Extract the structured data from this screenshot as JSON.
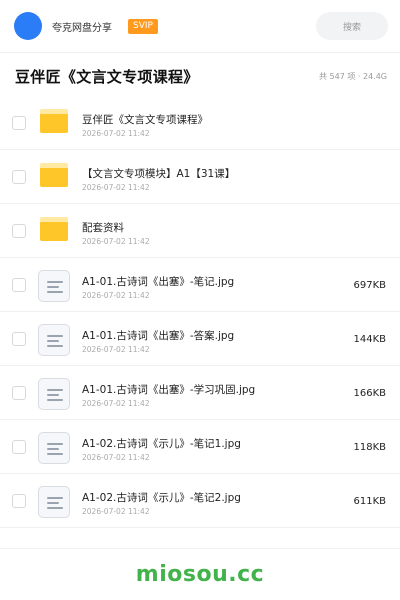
{
  "header": {
    "app_name": "夸克网盘分享",
    "badge": "SVIP",
    "search_placeholder": "搜索"
  },
  "folder": {
    "title": "豆伴匠《文言文专项课程》",
    "summary": "共 547 项 · 24.4G"
  },
  "items": [
    {
      "type": "folder",
      "name": "豆伴匠《文言文专项课程》",
      "date": "2026-07-02 11:42",
      "size": ""
    },
    {
      "type": "folder",
      "name": "【文言文专项模块】A1【31课】",
      "date": "2026-07-02 11:42",
      "size": ""
    },
    {
      "type": "folder",
      "name": "配套资料",
      "date": "2026-07-02 11:42",
      "size": ""
    },
    {
      "type": "file",
      "name": "A1-01.古诗词《出塞》-笔记.jpg",
      "date": "2026-07-02 11:42",
      "size": "697KB"
    },
    {
      "type": "file",
      "name": "A1-01.古诗词《出塞》-答案.jpg",
      "date": "2026-07-02 11:42",
      "size": "144KB"
    },
    {
      "type": "file",
      "name": "A1-01.古诗词《出塞》-学习巩固.jpg",
      "date": "2026-07-02 11:42",
      "size": "166KB"
    },
    {
      "type": "file",
      "name": "A1-02.古诗词《示儿》-笔记1.jpg",
      "date": "2026-07-02 11:42",
      "size": "118KB"
    },
    {
      "type": "file",
      "name": "A1-02.古诗词《示儿》-笔记2.jpg",
      "date": "2026-07-02 11:42",
      "size": "611KB"
    }
  ],
  "icons": {
    "folder": "folder-icon",
    "file": "document-icon"
  },
  "colors": {
    "accent": "#2b7cf7",
    "badge": "#ff9a1f",
    "folder": "#ffc629",
    "watermark": "#41b34a"
  },
  "footer": {
    "watermark": "miosou.cc"
  }
}
